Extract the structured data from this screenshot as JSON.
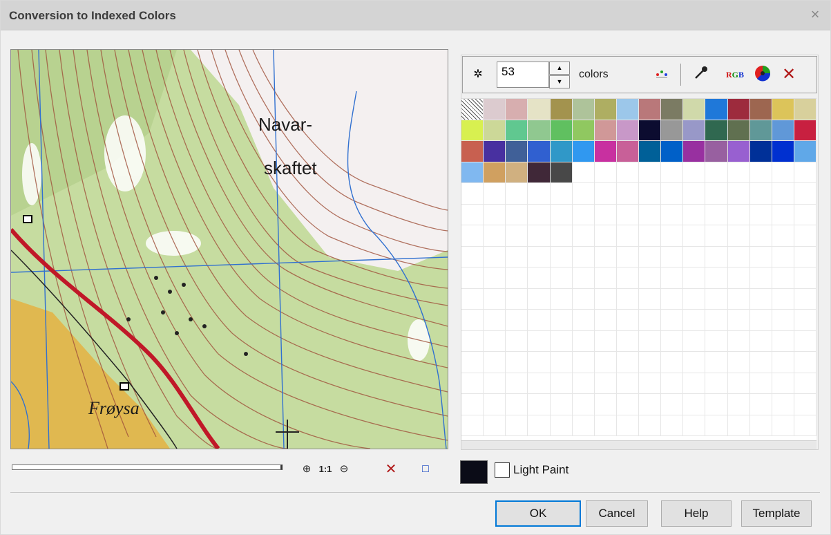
{
  "window": {
    "title": "Conversion to Indexed Colors",
    "close_glyph": "×"
  },
  "map_labels": {
    "label1": "Navar-",
    "label2": "skaftet",
    "label3": "Frøysa"
  },
  "zoom": {
    "zoom_in": "⊕",
    "one_to_one": "1:1",
    "zoom_out": "⊖",
    "clear": "✕",
    "frame": "□"
  },
  "palette_toolbar": {
    "count": "53",
    "count_label": "colors"
  },
  "palette_colors": [
    "transparent",
    "#dccbcf",
    "#d7aeaf",
    "#e5e3c6",
    "#a3934e",
    "#aec39a",
    "#aeae62",
    "#9cc7ea",
    "#b9787a",
    "#7b7b63",
    "#d0d9aa",
    "#1f78d9",
    "#9d2b3d",
    "#9d6650",
    "#dcc45a",
    "#d8d09c",
    "#d8f050",
    "#ccd898",
    "#60c890",
    "#90c890",
    "#60c060",
    "#90c860",
    "#d09898",
    "#c898c8",
    "#0c0c30",
    "#989898",
    "#9898c8",
    "#306850",
    "#607050",
    "#609898",
    "#6098d8",
    "#c82040",
    "#c86050",
    "#4830a0",
    "#406098",
    "#3060d0",
    "#3098c8",
    "#3098f0",
    "#c830a0",
    "#c86098",
    "#006098",
    "#0060c8",
    "#9830a0",
    "#9860a0",
    "#9860d0",
    "#003098",
    "#0030d0",
    "#60a8e8",
    "#80b8f0",
    "#d0a060",
    "#d0b080",
    "#402838",
    "#484848"
  ],
  "light_paint": {
    "label": "Light Paint"
  },
  "buttons": {
    "ok": "OK",
    "cancel": "Cancel",
    "help": "Help",
    "template": "Template"
  }
}
